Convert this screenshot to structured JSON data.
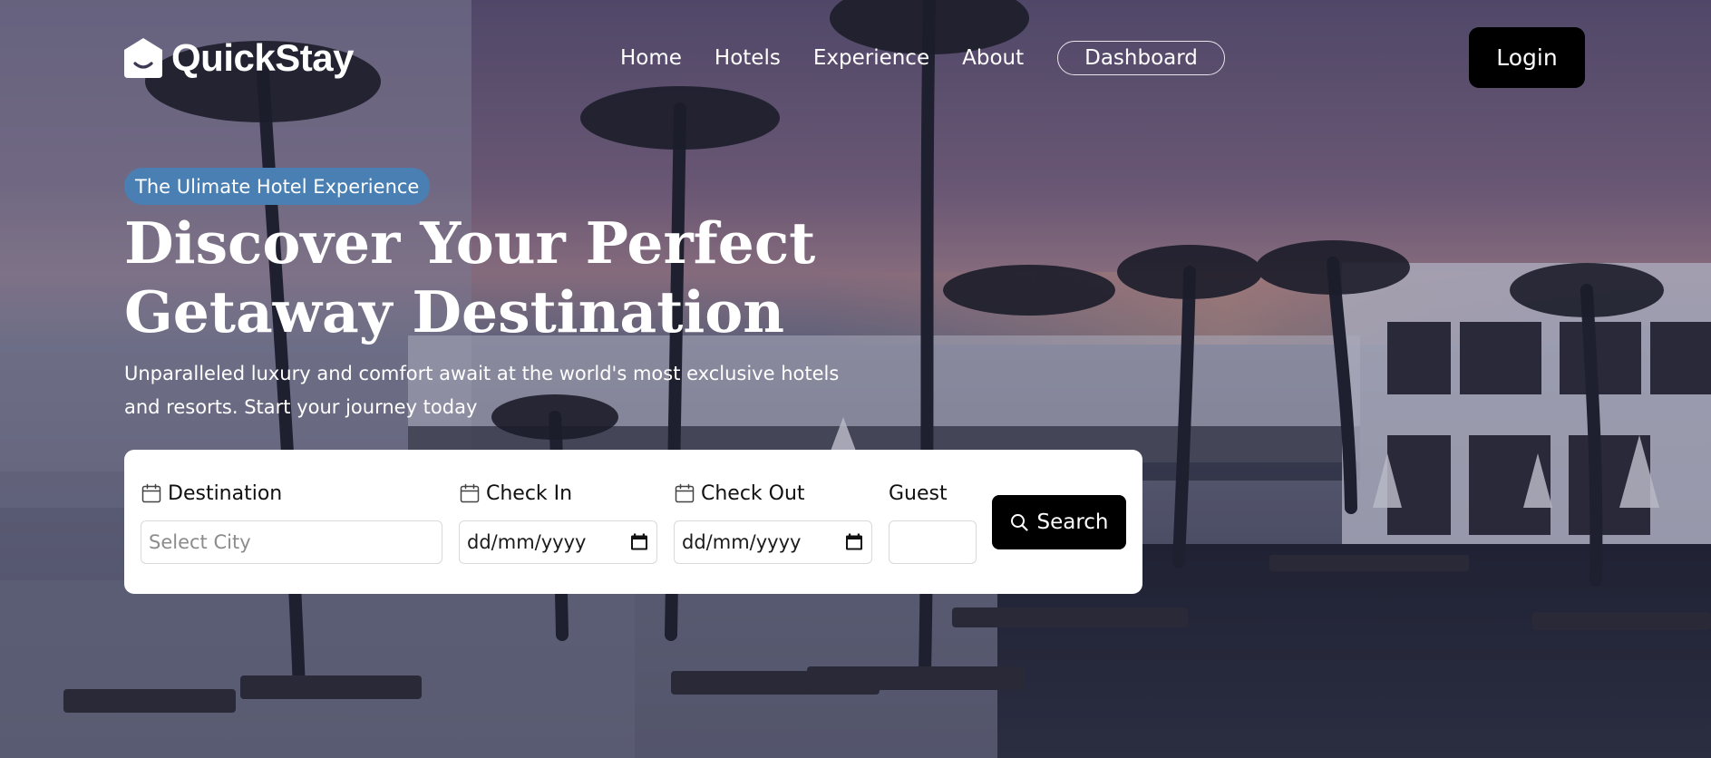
{
  "brand": {
    "name": "QuickStay"
  },
  "nav": {
    "links": [
      "Home",
      "Hotels",
      "Experience",
      "About"
    ],
    "dashboard_label": "Dashboard",
    "login_label": "Login"
  },
  "hero": {
    "badge": "The Ulimate Hotel Experience",
    "headline_line1": "Discover Your Perfect",
    "headline_line2": "Getaway Destination",
    "subtext": "Unparalleled luxury and comfort await at the world's most exclusive hotels and resorts. Start your journey today"
  },
  "search": {
    "destination": {
      "label": "Destination",
      "placeholder": "Select City",
      "value": ""
    },
    "check_in": {
      "label": "Check In",
      "value": "dd/mm/yyyy"
    },
    "check_out": {
      "label": "Check Out",
      "value": "dd/mm/yyyy"
    },
    "guest": {
      "label": "Guest",
      "value": ""
    },
    "button_label": "Search"
  },
  "icons": {
    "logo": "house-smile-icon",
    "field": "calendar-icon",
    "date_picker": "calendar-picker-icon",
    "search": "search-icon"
  },
  "colors": {
    "badge_bg": "#4a7fb3",
    "button_bg": "#000000",
    "card_bg": "#ffffff",
    "text_light": "#ffffff"
  }
}
